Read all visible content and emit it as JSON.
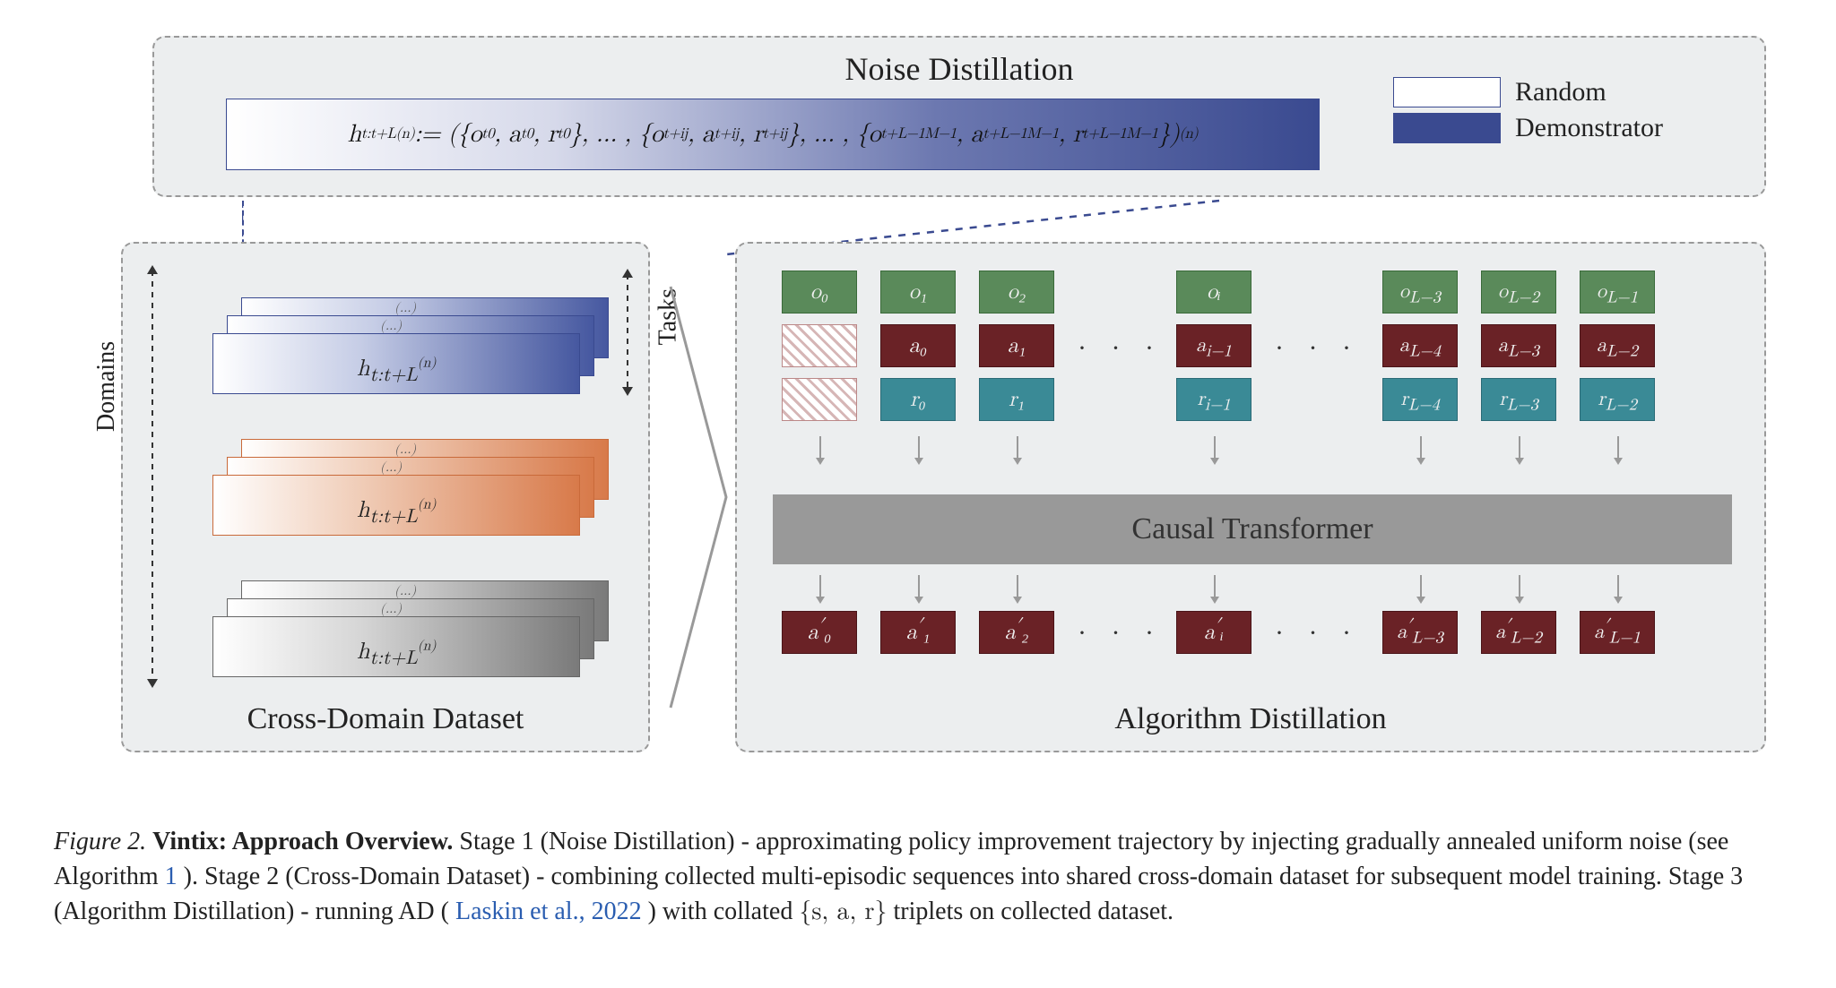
{
  "noise_distillation": {
    "title": "Noise Distillation",
    "formula_html": "h<sub>t:t+L</sub><sup>(n)</sup> := ({o<sub>t</sub><sup>0</sup>, a<sub>t</sub><sup>0</sup>, r<sub>t</sub><sup>0</sup>}, … , {o<sub>t+i</sub><sup>j</sup>, a<sub>t+i</sub><sup>j</sup>, r<sub>t+i</sub><sup>j</sup>}, … , {o<sub>t+L−1</sub><sup>M−1</sup>, a<sub>t+L−1</sub><sup>M−1</sup>, r<sub>t+L−1</sub><sup>M−1</sup>})<sup>(n)</sup>",
    "legend": {
      "random": "Random",
      "demonstrator": "Demonstrator"
    }
  },
  "cross_domain": {
    "title": "Cross-Domain Dataset",
    "domains_label": "Domains",
    "tasks_label": "Tasks",
    "card_label_html": "h<sub>t:t+L</sub><sup>(n)</sup>",
    "small_label_html": "(…)"
  },
  "algorithm_distillation": {
    "title": "Algorithm Distillation",
    "transformer_label": "Causal Transformer",
    "tokens": {
      "obs": [
        "o₀",
        "o₁",
        "o₂",
        "oᵢ",
        "o_{L−3}",
        "o_{L−2}",
        "o_{L−1}"
      ],
      "act": [
        "",
        "a₀",
        "a₁",
        "a_{i−1}",
        "a_{L−4}",
        "a_{L−3}",
        "a_{L−2}"
      ],
      "rew": [
        "",
        "r₀",
        "r₁",
        "r_{i−1}",
        "r_{L−4}",
        "r_{L−3}",
        "r_{L−2}"
      ],
      "out": [
        "a′₀",
        "a′₁",
        "a′₂",
        "a′ᵢ",
        "a′_{L−3}",
        "a′_{L−2}",
        "a′_{L−1}"
      ]
    },
    "dots": "·   ·   ·"
  },
  "caption": {
    "fignum": "Figure 2.",
    "title": "Vintix: Approach Overview.",
    "body_1": " Stage 1 (Noise Distillation) - approximating policy improvement trajectory by injecting gradually annealed uniform noise (see Algorithm ",
    "alg_ref": "1",
    "body_2": "). Stage 2 (Cross-Domain Dataset) - combining collected multi-episodic sequences into shared cross-domain dataset for subsequent model training. Stage 3 (Algorithm Distillation) - running AD (",
    "cite": "Laskin et al., 2022",
    "body_3": ") with collated ",
    "triplet": "{s, a, r}",
    "body_4": " triplets on collected dataset."
  },
  "chart_data": {
    "type": "diagram",
    "components": [
      {
        "name": "Noise Distillation",
        "desc": "gradient bar white→blue representing policy noise annealing",
        "math": "h^{(n)}_{t:t+L} := ({o^0_t,a^0_t,r^0_t},…,{o^j_{t+i},a^j_{t+i},r^j_{t+i}},…,{o^{M-1}_{t+L-1},a^{M-1}_{t+L-1},r^{M-1}_{t+L-1}})^{(n)}",
        "legend": {
          "white": "Random",
          "blue": "Demonstrator"
        }
      },
      {
        "name": "Cross-Domain Dataset",
        "desc": "stacks of h^{(n)}_{t:t+L} cards along Domains (vertical) × Tasks (depth) axes; three domain colors blue/orange/gray"
      },
      {
        "name": "Algorithm Distillation",
        "desc": "o/a/r token columns feed into Causal Transformer which outputs a' tokens",
        "columns": [
          {
            "o": "o_0",
            "a": null,
            "r": null,
            "out": "a'_0"
          },
          {
            "o": "o_1",
            "a": "a_0",
            "r": "r_0",
            "out": "a'_1"
          },
          {
            "o": "o_2",
            "a": "a_1",
            "r": "r_1",
            "out": "a'_2"
          },
          {
            "o": "o_i",
            "a": "a_{i-1}",
            "r": "r_{i-1}",
            "out": "a'_i"
          },
          {
            "o": "o_{L-3}",
            "a": "a_{L-4}",
            "r": "r_{L-4}",
            "out": "a'_{L-3}"
          },
          {
            "o": "o_{L-2}",
            "a": "a_{L-3}",
            "r": "r_{L-3}",
            "out": "a'_{L-2}"
          },
          {
            "o": "o_{L-1}",
            "a": "a_{L-2}",
            "r": "r_{L-2}",
            "out": "a'_{L-1}"
          }
        ]
      }
    ]
  }
}
